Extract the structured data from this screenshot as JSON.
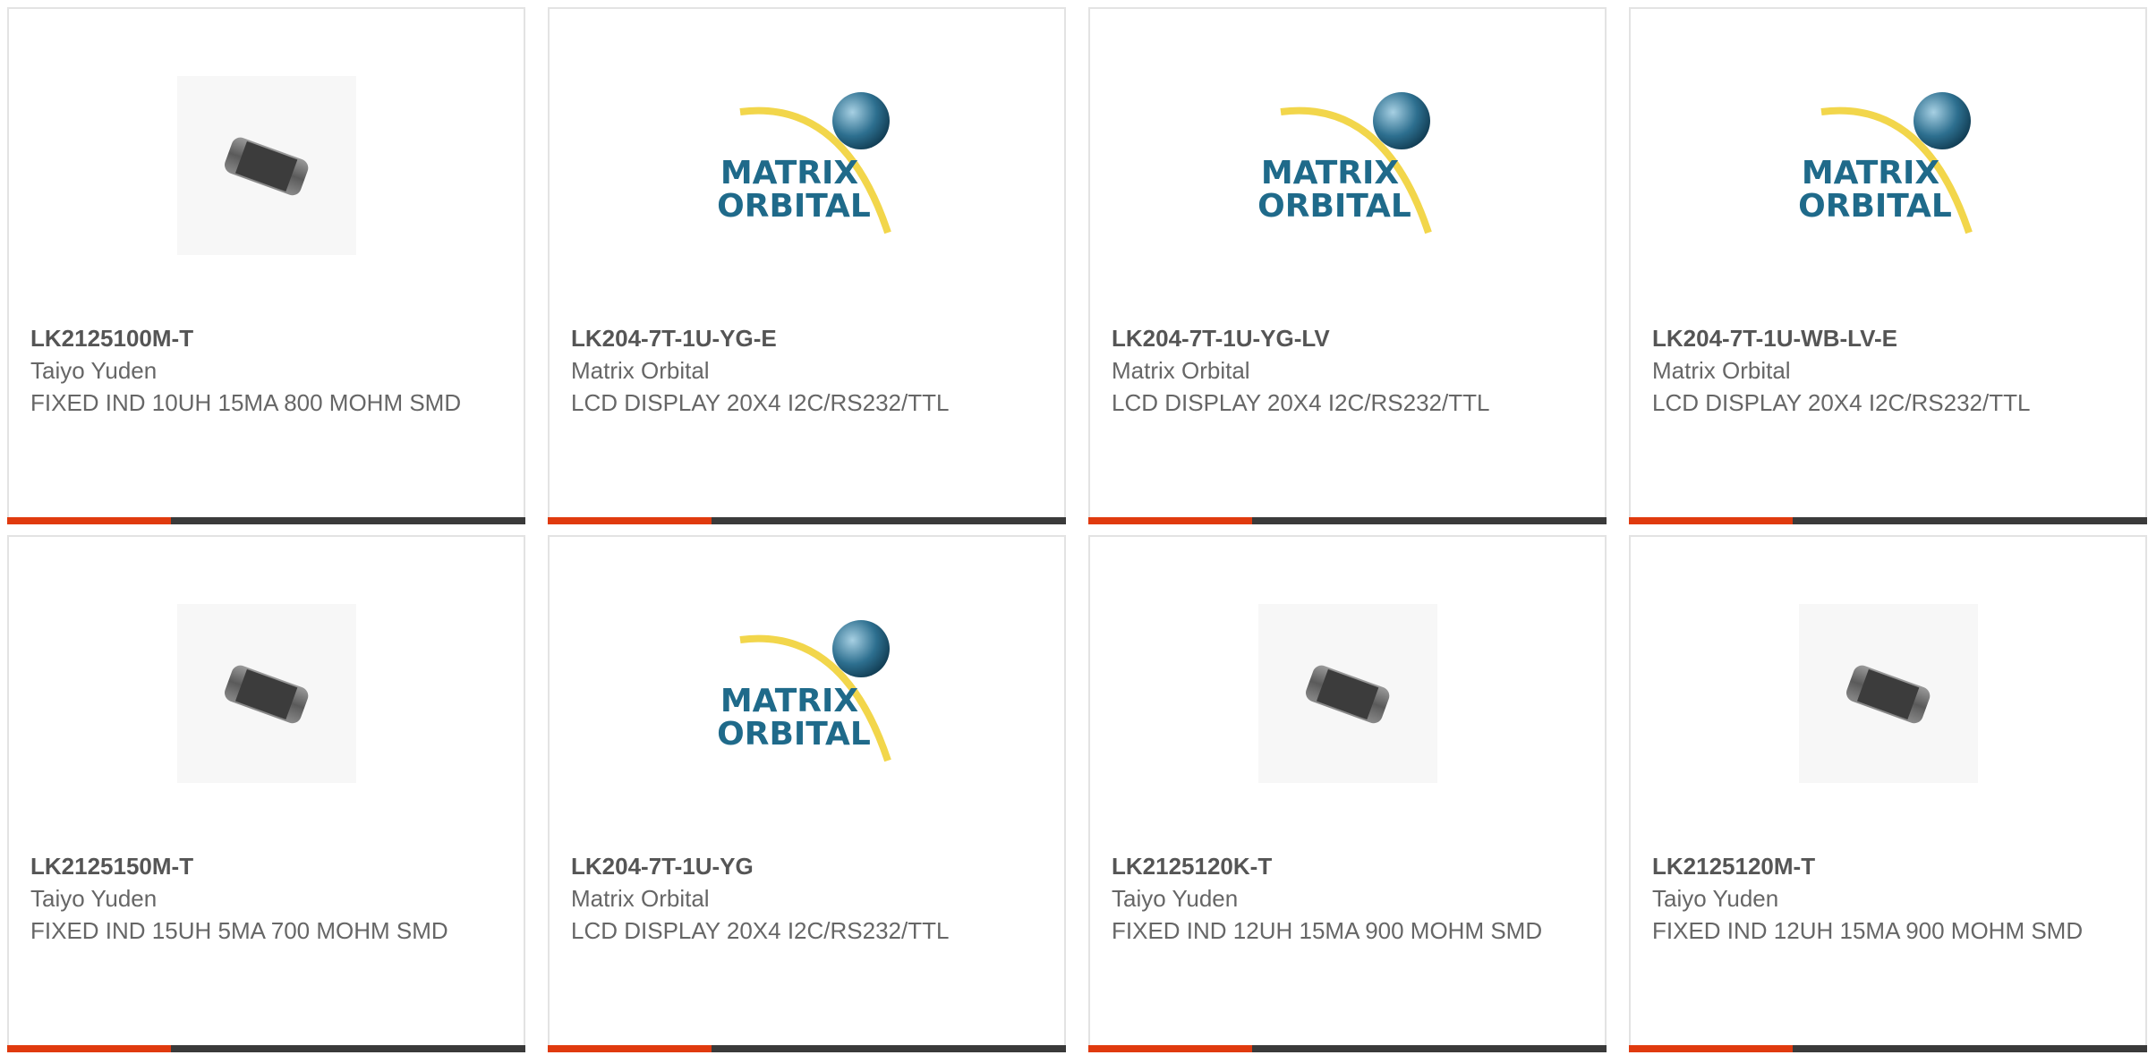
{
  "colors": {
    "accent": "#e03a0e",
    "bar": "#3a3a3a",
    "border": "#e3e3e3",
    "logo_blue": "#1f6a8a",
    "logo_yellow": "#f2d64b"
  },
  "products": [
    {
      "part_number": "LK2125100M-T",
      "manufacturer": "Taiyo Yuden",
      "description": "FIXED IND 10UH 15MA 800 MOHM SMD",
      "image": "inductor-chip-image"
    },
    {
      "part_number": "LK204-7T-1U-YG-E",
      "manufacturer": "Matrix Orbital",
      "description": "LCD DISPLAY 20X4 I2C/RS232/TTL",
      "image": "matrix-orbital-logo",
      "logo_line1": "MATRIX",
      "logo_line2": "ORBITAL"
    },
    {
      "part_number": "LK204-7T-1U-YG-LV",
      "manufacturer": "Matrix Orbital",
      "description": "LCD DISPLAY 20X4 I2C/RS232/TTL",
      "image": "matrix-orbital-logo",
      "logo_line1": "MATRIX",
      "logo_line2": "ORBITAL"
    },
    {
      "part_number": "LK204-7T-1U-WB-LV-E",
      "manufacturer": "Matrix Orbital",
      "description": "LCD DISPLAY 20X4 I2C/RS232/TTL",
      "image": "matrix-orbital-logo",
      "logo_line1": "MATRIX",
      "logo_line2": "ORBITAL"
    },
    {
      "part_number": "LK2125150M-T",
      "manufacturer": "Taiyo Yuden",
      "description": "FIXED IND 15UH 5MA 700 MOHM SMD",
      "image": "inductor-chip-image"
    },
    {
      "part_number": "LK204-7T-1U-YG",
      "manufacturer": "Matrix Orbital",
      "description": "LCD DISPLAY 20X4 I2C/RS232/TTL",
      "image": "matrix-orbital-logo",
      "logo_line1": "MATRIX",
      "logo_line2": "ORBITAL"
    },
    {
      "part_number": "LK2125120K-T",
      "manufacturer": "Taiyo Yuden",
      "description": "FIXED IND 12UH 15MA 900 MOHM SMD",
      "image": "inductor-chip-image"
    },
    {
      "part_number": "LK2125120M-T",
      "manufacturer": "Taiyo Yuden",
      "description": "FIXED IND 12UH 15MA 900 MOHM SMD",
      "image": "inductor-chip-image"
    }
  ]
}
